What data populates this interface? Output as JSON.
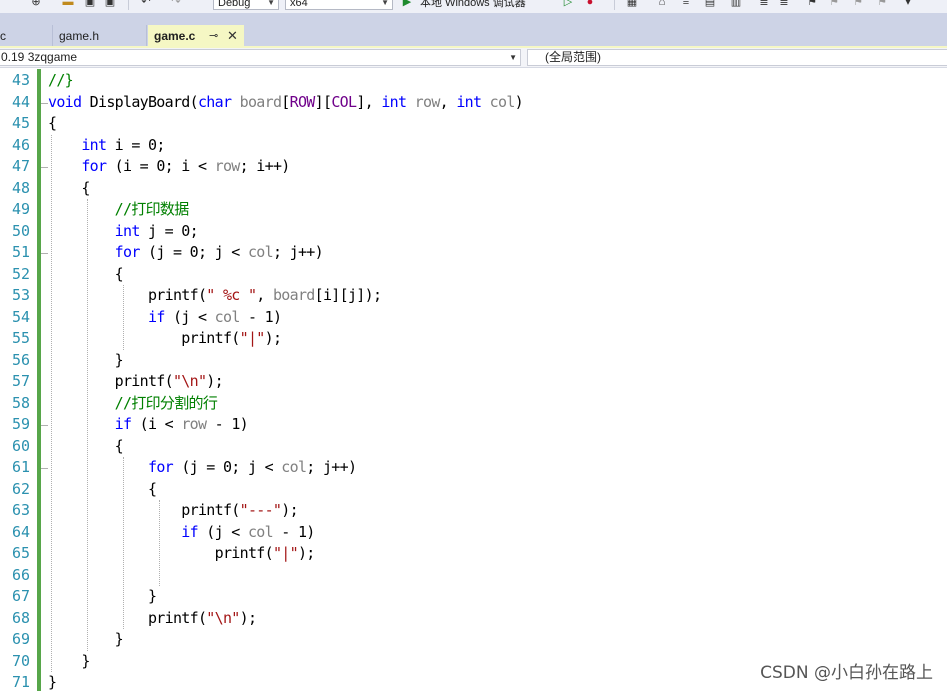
{
  "toolbar": {
    "config_value": "Debug",
    "platform_value": "x64",
    "run_label": "本地 Windows 调试器"
  },
  "tabs": [
    {
      "label": "c",
      "active": false
    },
    {
      "label": "game.h",
      "active": false
    },
    {
      "label": "game.c",
      "active": true
    }
  ],
  "navbar": {
    "project": "0.19 3zqgame",
    "scope": "(全局范围)"
  },
  "editor": {
    "line_numbers": [
      "43",
      "44",
      "45",
      "46",
      "47",
      "48",
      "49",
      "50",
      "51",
      "52",
      "53",
      "54",
      "55",
      "56",
      "57",
      "58",
      "59",
      "60",
      "61",
      "62",
      "63",
      "64",
      "65",
      "66",
      "67",
      "68",
      "69",
      "70",
      "71"
    ],
    "code": [
      "//}",
      "void DisplayBoard(char board[ROW][COL], int row, int col)",
      "{",
      "    int i = 0;",
      "    for (i = 0; i < row; i++)",
      "    {",
      "        //打印数据",
      "        int j = 0;",
      "        for (j = 0; j < col; j++)",
      "        {",
      "            printf(\" %c \", board[i][j]);",
      "            if (j < col - 1)",
      "                printf(\"|\");",
      "        }",
      "        printf(\"\\n\");",
      "        //打印分割的行",
      "        if (i < row - 1)",
      "        {",
      "            for (j = 0; j < col; j++)",
      "            {",
      "                printf(\"---\");",
      "                if (j < col - 1)",
      "                    printf(\"|\");",
      "",
      "            }",
      "            printf(\"\\n\");",
      "        }",
      "    }",
      "}"
    ]
  },
  "watermark": "CSDN @小白孙在路上",
  "colors": {
    "keyword": "#0000ff",
    "comment": "#008000",
    "string": "#a31515",
    "macro": "#6f008a",
    "line_number": "#2b91af",
    "change_bar": "#57a64a",
    "active_tab": "#f5f7c4"
  }
}
